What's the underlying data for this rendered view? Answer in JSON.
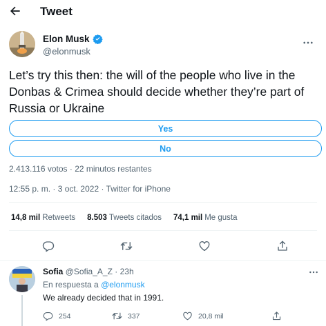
{
  "header": {
    "title": "Tweet",
    "back_icon": "arrow-left-icon"
  },
  "author": {
    "name": "Elon Musk",
    "handle": "@elonmusk",
    "verified": true,
    "verified_color": "#1d9bf0"
  },
  "tweet": {
    "text": "Let’s try this then: the will of the people who live in the Donbas & Crimea should decide whether they’re part of Russia or Ukraine"
  },
  "poll": {
    "options": [
      {
        "label": "Yes"
      },
      {
        "label": "No"
      }
    ],
    "votes": "2.413.116 votos",
    "time_left": "22 minutos restantes",
    "separator": "·"
  },
  "timestamp": {
    "time": "12:55 p. m.",
    "date": "3 oct. 2022",
    "source": "Twitter for iPhone",
    "separator": "·"
  },
  "stats": [
    {
      "value": "14,8 mil",
      "label": "Retweets"
    },
    {
      "value": "8.503",
      "label": "Tweets citados"
    },
    {
      "value": "74,1 mil",
      "label": "Me gusta"
    }
  ],
  "actions": [
    "reply-icon",
    "retweet-icon",
    "like-icon",
    "share-icon"
  ],
  "reply": {
    "name": "Sofia",
    "handle": "@Sofia_A_Z",
    "separator": "·",
    "time": "23h",
    "replying_to_prefix": "En respuesta a",
    "replying_to": "@elonmusk",
    "text": "We already decided that in 1991.",
    "counts": {
      "replies": "254",
      "retweets": "337",
      "likes": "20,8 mil"
    }
  },
  "colors": {
    "accent": "#1d9bf0",
    "text_primary": "#0f1419",
    "text_secondary": "#536471",
    "divider": "#eff3f4"
  }
}
